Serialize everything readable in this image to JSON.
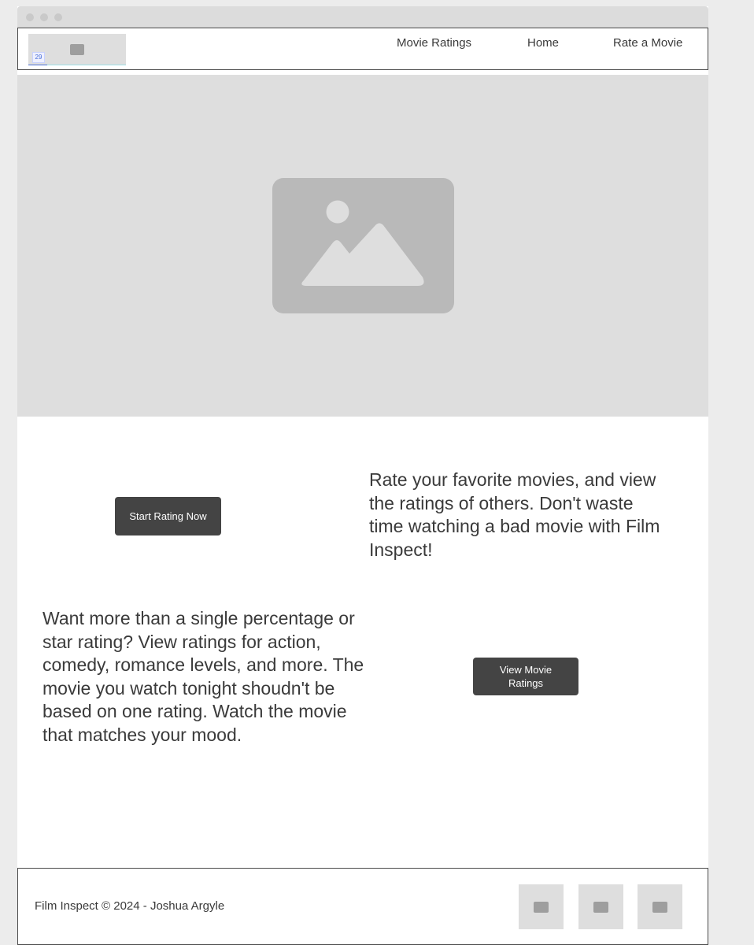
{
  "nav": {
    "logo_badge": "29",
    "links": [
      "Movie Ratings",
      "Home",
      "Rate a Movie"
    ]
  },
  "cta1": {
    "button": "Start Rating Now",
    "text": "Rate your favorite movies, and view the ratings of others. Don't waste time watching a bad movie with Film Inspect!"
  },
  "cta2": {
    "text": "Want more than a single percentage or star rating? View ratings for action, comedy, romance levels, and more. The movie you watch tonight shoudn't be based on one rating. Watch the movie that matches your mood.",
    "button": "View Movie Ratings"
  },
  "footer": {
    "copyright": "Film Inspect © 2024 - Joshua Argyle",
    "social_icons": [
      "image-icon",
      "image-icon",
      "image-icon"
    ]
  },
  "colors": {
    "placeholder_bg": "#dedede",
    "button_bg": "#444444",
    "text": "#3a3a3a"
  }
}
